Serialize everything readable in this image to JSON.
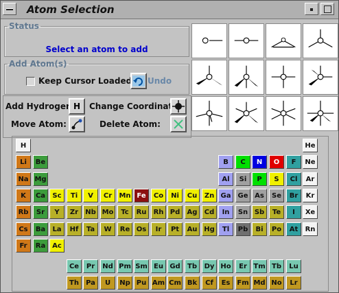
{
  "window": {
    "title": "Atom Selection"
  },
  "status": {
    "legend": "Status",
    "message": "Select an atom to add"
  },
  "add_atoms": {
    "legend": "Add Atom(s)",
    "keep_cursor_label": "Keep Cursor Loaded",
    "undo_label": "Undo"
  },
  "tools": {
    "add_hydrogen_label": "Add Hydrogen:",
    "hydrogen_button_label": "H",
    "change_coordinate_label": "Change Coordinate:",
    "move_atom_label": "Move Atom:",
    "delete_atom_label": "Delete Atom:"
  },
  "geometries": [
    "linear-one",
    "linear-two",
    "trigonal-planar",
    "trigonal-three",
    "tetrahedral",
    "trigonal-pyramid",
    "square-planar",
    "seesaw",
    "trigonal-bipyramid",
    "square-pyramid",
    "octahedral-flat",
    "octahedral"
  ],
  "colors": {
    "alkali": "#d07818",
    "alkaline": "#3c9c3c",
    "transition": "#e8e800",
    "post_transition": "#b8b028",
    "metalloid": "#a0a0a0",
    "nonmetal": "#8cc0c0",
    "halogen": "#30a0a0",
    "noble": "#f0f0f0",
    "selected": "#8c1010",
    "lanthanide": "#78c8b0",
    "actinide": "#c09820",
    "boron_group": "#a0a0ff"
  },
  "periodic_table": {
    "elements": [
      {
        "s": "H",
        "c": "noble"
      },
      {
        "s": "He",
        "c": "noble"
      },
      {
        "s": "Li",
        "c": "alkali"
      },
      {
        "s": "Be",
        "c": "alkaline"
      },
      {
        "s": "B",
        "c": "b"
      },
      {
        "s": "C",
        "c": "g"
      },
      {
        "s": "N",
        "c": "n"
      },
      {
        "s": "O",
        "c": "o"
      },
      {
        "s": "F",
        "c": "halogen"
      },
      {
        "s": "Ne",
        "c": "noble"
      },
      {
        "s": "Na",
        "c": "alkali"
      },
      {
        "s": "Mg",
        "c": "alkaline"
      },
      {
        "s": "Al",
        "c": "b"
      },
      {
        "s": "Si",
        "c": "metalloid"
      },
      {
        "s": "P",
        "c": "g"
      },
      {
        "s": "S",
        "c": "y"
      },
      {
        "s": "Cl",
        "c": "halogen"
      },
      {
        "s": "Ar",
        "c": "noble"
      },
      {
        "s": "K",
        "c": "alkali"
      },
      {
        "s": "Ca",
        "c": "alkaline"
      },
      {
        "s": "Sc",
        "c": "y"
      },
      {
        "s": "Ti",
        "c": "y"
      },
      {
        "s": "V",
        "c": "y"
      },
      {
        "s": "Cr",
        "c": "y"
      },
      {
        "s": "Mn",
        "c": "y"
      },
      {
        "s": "Fe",
        "c": "selected"
      },
      {
        "s": "Co",
        "c": "y"
      },
      {
        "s": "Ni",
        "c": "y"
      },
      {
        "s": "Cu",
        "c": "y"
      },
      {
        "s": "Zn",
        "c": "y"
      },
      {
        "s": "Ga",
        "c": "b"
      },
      {
        "s": "Ge",
        "c": "metalloid"
      },
      {
        "s": "As",
        "c": "metalloid"
      },
      {
        "s": "Se",
        "c": "metalloid"
      },
      {
        "s": "Br",
        "c": "halogen"
      },
      {
        "s": "Kr",
        "c": "noble"
      },
      {
        "s": "Rb",
        "c": "alkali"
      },
      {
        "s": "Sr",
        "c": "alkaline"
      },
      {
        "s": "Y",
        "c": "pt"
      },
      {
        "s": "Zr",
        "c": "pt"
      },
      {
        "s": "Nb",
        "c": "pt"
      },
      {
        "s": "Mo",
        "c": "pt"
      },
      {
        "s": "Tc",
        "c": "pt"
      },
      {
        "s": "Ru",
        "c": "pt"
      },
      {
        "s": "Rh",
        "c": "pt"
      },
      {
        "s": "Pd",
        "c": "pt"
      },
      {
        "s": "Ag",
        "c": "pt"
      },
      {
        "s": "Cd",
        "c": "pt"
      },
      {
        "s": "In",
        "c": "b"
      },
      {
        "s": "Sn",
        "c": "metalloid"
      },
      {
        "s": "Sb",
        "c": "pt"
      },
      {
        "s": "Te",
        "c": "pt"
      },
      {
        "s": "I",
        "c": "halogen"
      },
      {
        "s": "Xe",
        "c": "noble"
      },
      {
        "s": "Cs",
        "c": "alkali"
      },
      {
        "s": "Ba",
        "c": "alkaline"
      },
      {
        "s": "La",
        "c": "pt"
      },
      {
        "s": "Hf",
        "c": "pt"
      },
      {
        "s": "Ta",
        "c": "pt"
      },
      {
        "s": "W",
        "c": "pt"
      },
      {
        "s": "Re",
        "c": "pt"
      },
      {
        "s": "Os",
        "c": "pt"
      },
      {
        "s": "Ir",
        "c": "pt"
      },
      {
        "s": "Pt",
        "c": "pt"
      },
      {
        "s": "Au",
        "c": "pt"
      },
      {
        "s": "Hg",
        "c": "pt"
      },
      {
        "s": "Tl",
        "c": "b"
      },
      {
        "s": "Pb",
        "c": "dk"
      },
      {
        "s": "Bi",
        "c": "pt"
      },
      {
        "s": "Po",
        "c": "pt"
      },
      {
        "s": "At",
        "c": "halogen"
      },
      {
        "s": "Rn",
        "c": "noble"
      },
      {
        "s": "Fr",
        "c": "alkali"
      },
      {
        "s": "Ra",
        "c": "alkaline"
      },
      {
        "s": "Ac",
        "c": "y"
      },
      {
        "s": "Ce",
        "c": "lanthanide"
      },
      {
        "s": "Pr",
        "c": "lanthanide"
      },
      {
        "s": "Nd",
        "c": "lanthanide"
      },
      {
        "s": "Pm",
        "c": "lanthanide"
      },
      {
        "s": "Sm",
        "c": "lanthanide"
      },
      {
        "s": "Eu",
        "c": "lanthanide"
      },
      {
        "s": "Gd",
        "c": "lanthanide"
      },
      {
        "s": "Tb",
        "c": "lanthanide"
      },
      {
        "s": "Dy",
        "c": "lanthanide"
      },
      {
        "s": "Ho",
        "c": "lanthanide"
      },
      {
        "s": "Er",
        "c": "lanthanide"
      },
      {
        "s": "Tm",
        "c": "lanthanide"
      },
      {
        "s": "Tb",
        "c": "lanthanide"
      },
      {
        "s": "Lu",
        "c": "lanthanide"
      },
      {
        "s": "Th",
        "c": "actinide"
      },
      {
        "s": "Pa",
        "c": "actinide"
      },
      {
        "s": "U",
        "c": "actinide"
      },
      {
        "s": "Np",
        "c": "actinide"
      },
      {
        "s": "Pu",
        "c": "actinide"
      },
      {
        "s": "Am",
        "c": "actinide"
      },
      {
        "s": "Cm",
        "c": "actinide"
      },
      {
        "s": "Bk",
        "c": "actinide"
      },
      {
        "s": "Cf",
        "c": "actinide"
      },
      {
        "s": "Es",
        "c": "actinide"
      },
      {
        "s": "Fm",
        "c": "actinide"
      },
      {
        "s": "Md",
        "c": "actinide"
      },
      {
        "s": "No",
        "c": "actinide"
      },
      {
        "s": "Lr",
        "c": "actinide"
      }
    ]
  }
}
